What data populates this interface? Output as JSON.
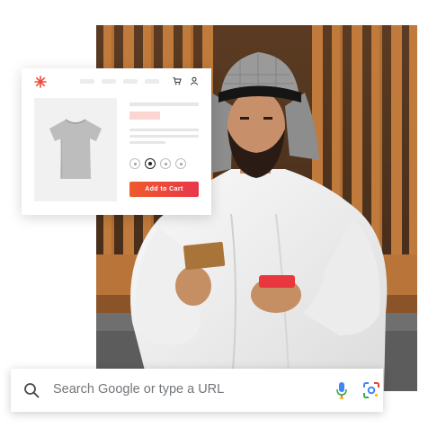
{
  "product_card": {
    "logo_icon": "snowflake-logo-icon",
    "header_icons": [
      "cart-icon",
      "user-icon"
    ],
    "size_options_count": 4,
    "selected_size_index": 1,
    "add_to_cart_label": "Add to Cart",
    "accent_color": "#ef4b3a"
  },
  "search_bar": {
    "placeholder": "Search Google or type a URL",
    "icons": [
      "search-icon",
      "microphone-icon",
      "google-lens-icon"
    ]
  },
  "photo": {
    "subject": "man in white thobe and keffiyeh holding a card and a phone"
  }
}
